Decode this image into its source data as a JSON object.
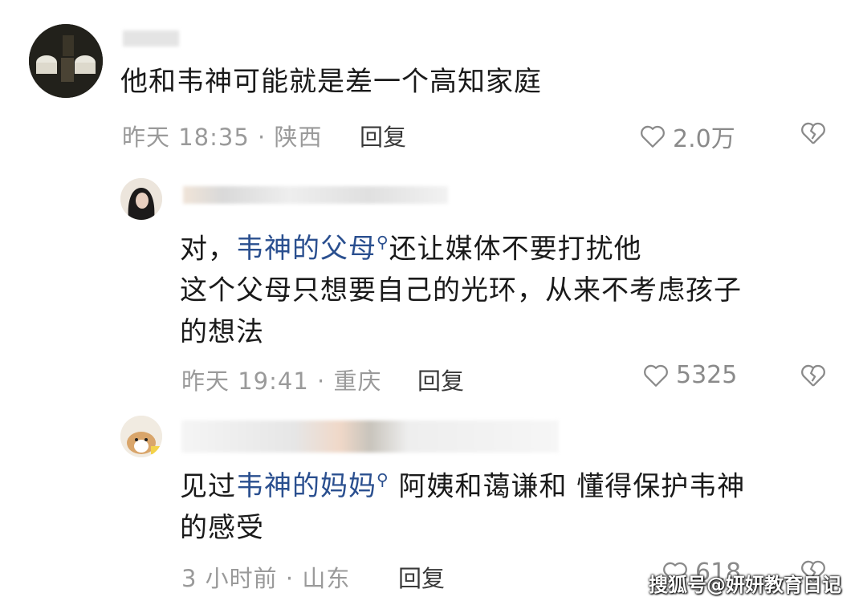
{
  "comments": [
    {
      "text": "他和韦神可能就是差一个高知家庭",
      "meta": "昨天 18:35 · 陕西",
      "reply_label": "回复",
      "likes": "2.0万"
    },
    {
      "prefix": "对，",
      "mention": "韦神的父母",
      "mention_icon": "search-icon",
      "suffix": "还让媒体不要打扰他",
      "line2": "这个父母只想要自己的光环，从来不考虑孩子",
      "line3": "的想法",
      "meta": "昨天 19:41 · 重庆",
      "reply_label": "回复",
      "likes": "5325"
    },
    {
      "prefix": "见过",
      "mention": "韦神的妈妈",
      "mention_icon": "search-icon",
      "suffix": " 阿姨和蔼谦和 懂得保护韦神",
      "line2": "的感受",
      "meta": "3 小时前 · 山东",
      "reply_label": "回复",
      "likes": "618"
    }
  ],
  "watermark": "搜狐号@妍妍教育日记",
  "colors": {
    "mention": "#2a4f8f",
    "meta": "#9a9a9a"
  }
}
